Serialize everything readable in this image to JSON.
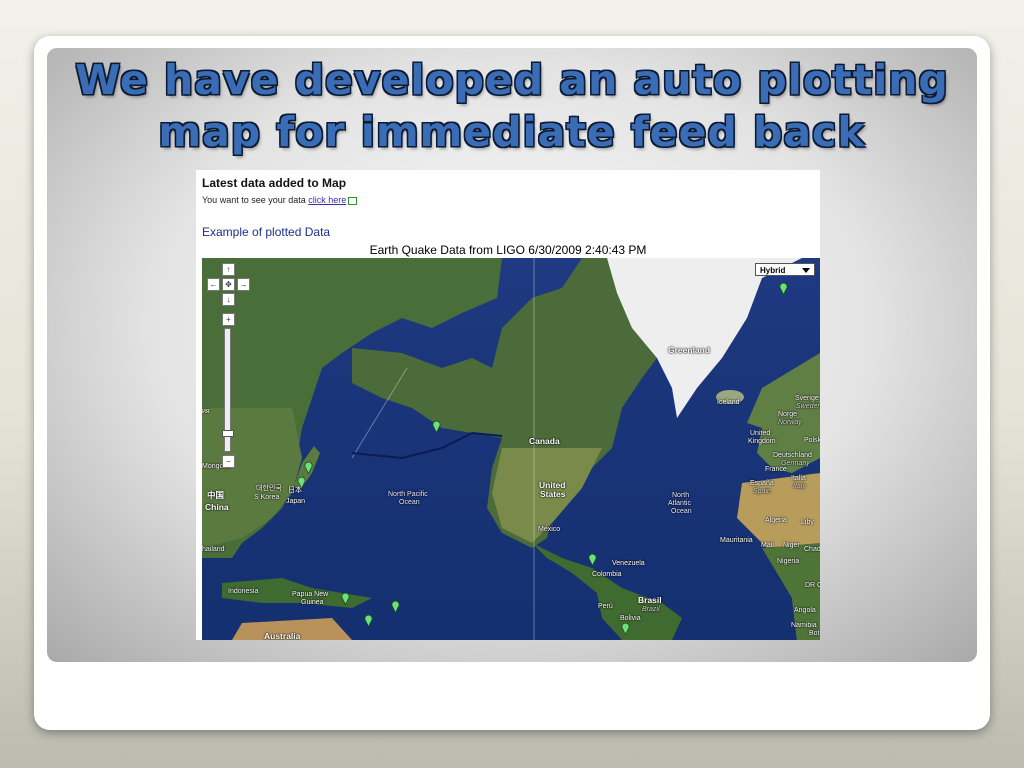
{
  "slide": {
    "title_line1": "We have developed an auto plotting",
    "title_line2": "map for immediate feed back"
  },
  "page": {
    "latest_heading": "Latest data added to Map",
    "see_data_prefix": "You want to see your data ",
    "see_data_link": "click here",
    "example_heading": "Example of plotted Data"
  },
  "map": {
    "title": "Earth Quake Data from LIGO 6/30/2009 2:40:43 PM",
    "map_type": "Hybrid",
    "controls": {
      "pan_up": "↑",
      "pan_left": "←",
      "pan_center": "✥",
      "pan_right": "→",
      "pan_down": "↓",
      "zoom_in": "+",
      "zoom_out": "−"
    },
    "colors": {
      "ocean": "#1a3479",
      "land": "#4a6e3a",
      "ice": "#f0f0f0",
      "marker": "#6ee07a"
    },
    "labels": {
      "greenland": "Greenland",
      "iceland": "Iceland",
      "canada": "Canada",
      "united_states_1": "United",
      "united_states_2": "States",
      "mexico": "México",
      "north_pacific_1": "North Pacific",
      "north_pacific_2": "Ocean",
      "north_atlantic_1": "North",
      "north_atlantic_2": "Atlantic",
      "north_atlantic_3": "Ocean",
      "mongolia": "Mongolia",
      "korea_native": "대한민국",
      "korea": "S Korea",
      "japan_native": "日本",
      "japan": "Japan",
      "china_native": "中国",
      "china": "China",
      "thailand": "hailand",
      "russia_fragment": "ия",
      "indonesia": "Indonesia",
      "png_1": "Papua New",
      "png_2": "Guinea",
      "australia": "Australia",
      "venezuela": "Venezuela",
      "colombia": "Colombia",
      "peru": "Perú",
      "brasil": "Brasil",
      "brazil_en": "Brazil",
      "bolivia": "Bolivia",
      "sverige": "Sverige",
      "sweden": "Sweden",
      "norge": "Norge",
      "norway": "Norway",
      "uk_1": "United",
      "uk_2": "Kingdom",
      "polska": "Polsk",
      "germany_de": "Deutschland",
      "germany": "Germany",
      "france": "France",
      "italia": "Italia",
      "italy": "Italy",
      "espana": "España",
      "spain": "Spain",
      "algeria": "Algeria",
      "libya": "Liby",
      "mauritania": "Mauritania",
      "mali": "Mali",
      "niger": "Niger",
      "chad": "Chad",
      "nigeria": "Nigeria",
      "drc": "DR C",
      "angola": "Angola",
      "namibia": "Namibia",
      "botswana": "Bots"
    }
  }
}
